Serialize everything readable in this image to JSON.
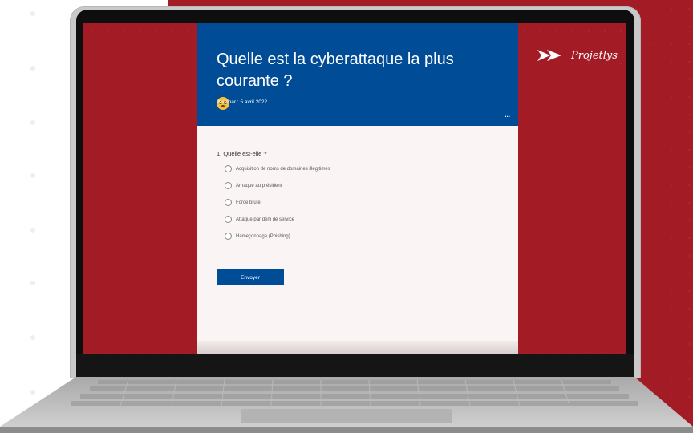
{
  "brand": {
    "name": "Projetlys"
  },
  "form": {
    "title": "Quelle est la cyberattaque la plus courante ?",
    "emoji_icon": "flushed-face-emoji",
    "subtitle": "Webinar : 5 avril 2022",
    "menu_label": "...",
    "question": "1. Quelle est-elle ?",
    "options": [
      "Acquisition de noms de domaines illégitimes",
      "Arnaque au président",
      "Force brute",
      "Attaque par déni de service",
      "Hameçonnage (Phishing)"
    ],
    "submit_label": "Envoyer"
  },
  "colors": {
    "brand_red": "#a31c25",
    "header_blue": "#004c97",
    "form_background": "#faf5f4"
  }
}
